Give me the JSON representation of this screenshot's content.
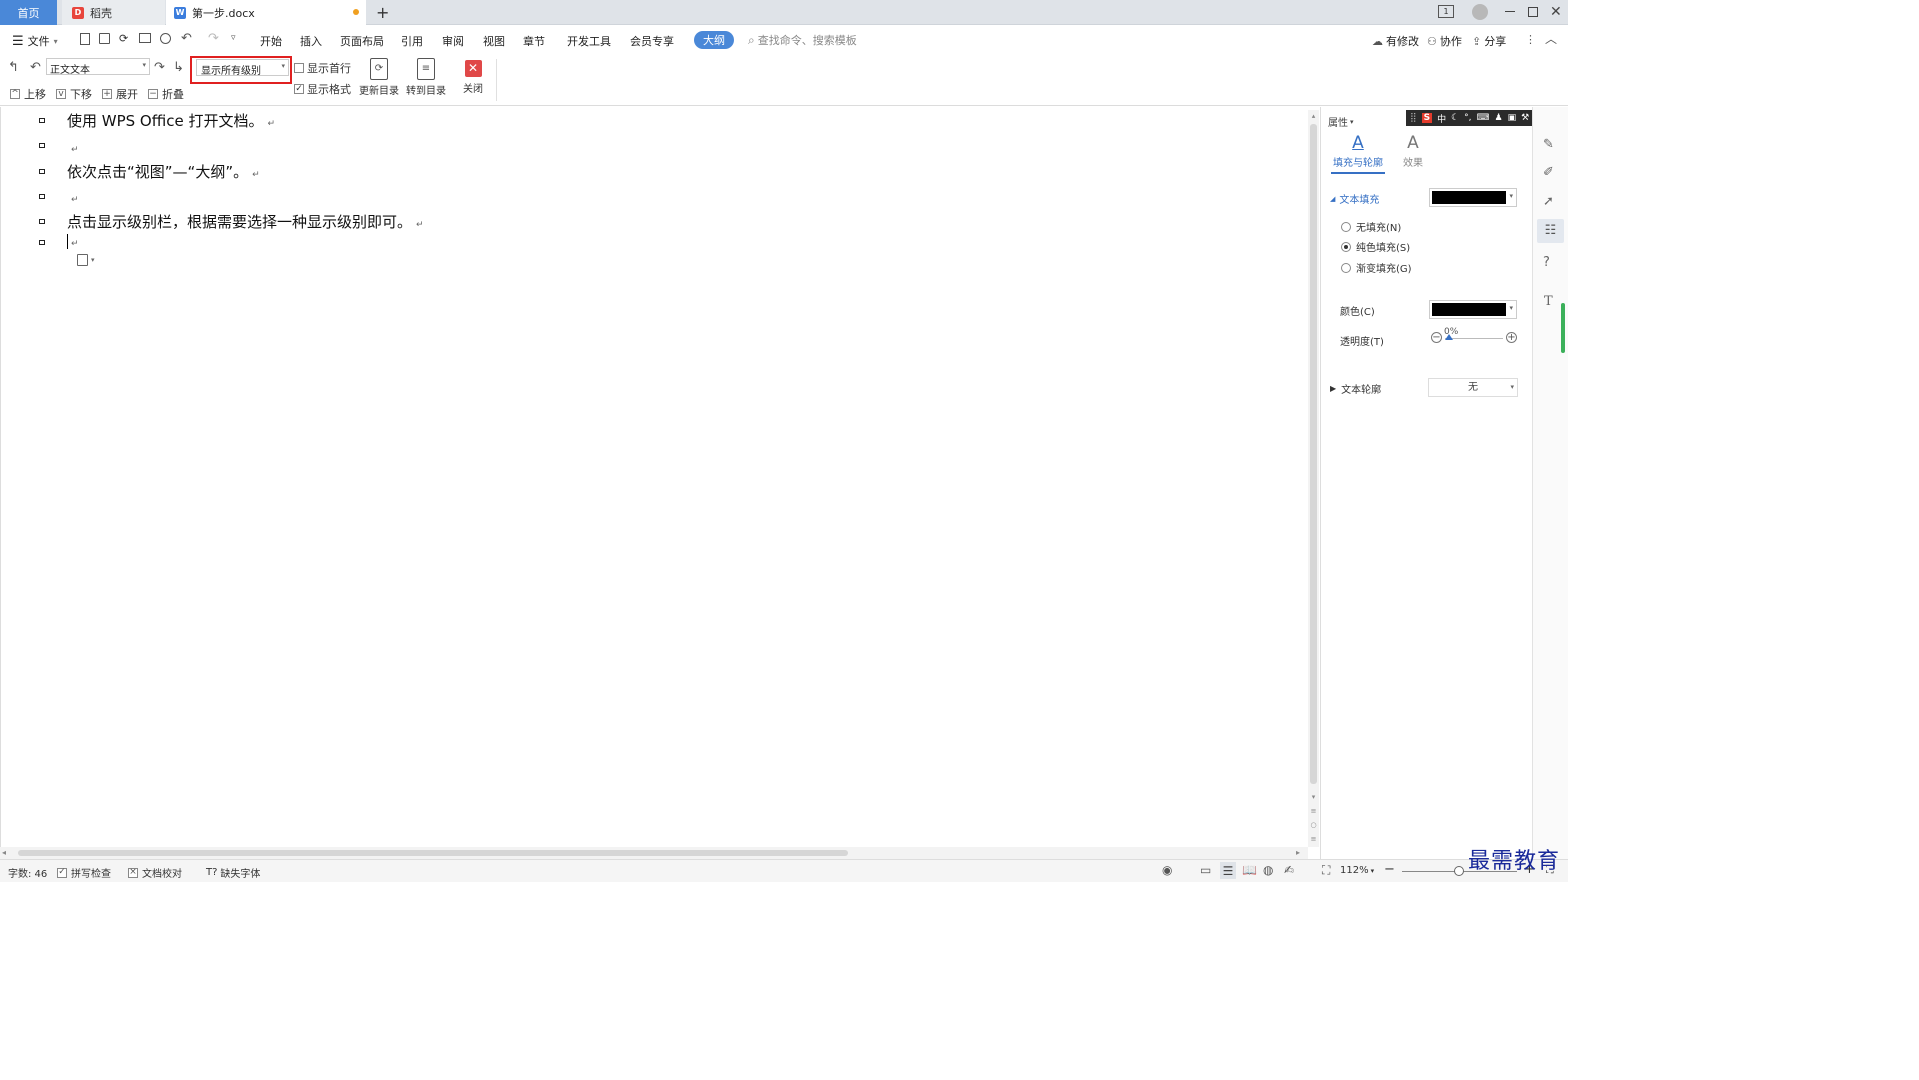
{
  "tabs": {
    "home": "首页",
    "daoke": "稻壳",
    "document": "第一步.docx",
    "new_tab": "+"
  },
  "menu": {
    "file": "文件",
    "items": [
      "开始",
      "插入",
      "页面布局",
      "引用",
      "审阅",
      "视图",
      "章节",
      "开发工具",
      "会员专享"
    ],
    "active": "大纲",
    "search_placeholder": "查找命令、搜索模板",
    "right": {
      "modified": "有修改",
      "collaborate": "协作",
      "share": "分享"
    }
  },
  "ribbon": {
    "style_select": "正文文本",
    "level_select": "显示所有级别",
    "show_first_line": "显示首行",
    "show_format": "显示格式",
    "update_toc": "更新目录",
    "goto_toc": "转到目录",
    "close": "关闭",
    "move_up": "上移",
    "move_down": "下移",
    "expand": "展开",
    "collapse": "折叠"
  },
  "document": {
    "paragraphs": [
      "使用 WPS Office 打开文档。",
      "",
      "依次点击“视图”—“大纲”。",
      "",
      "点击显示级别栏，根据需要选择一种显示级别即可。",
      ""
    ]
  },
  "panel": {
    "title": "属性",
    "tab_fill": "填充与轮廓",
    "tab_effect": "效果",
    "section_fill": "文本填充",
    "no_fill": "无填充(N)",
    "solid_fill": "纯色填充(S)",
    "gradient_fill": "渐变填充(G)",
    "color_label": "颜色(C)",
    "transparency_label": "透明度(T)",
    "transparency_value": "0%",
    "section_outline": "文本轮廓",
    "outline_value": "无",
    "fill_color": "#000000"
  },
  "ime": {
    "lang": "中"
  },
  "status": {
    "word_count": "字数: 46",
    "spell_check": "拼写检查",
    "doc_proof": "文档校对",
    "missing_font": "缺失字体",
    "zoom": "112%"
  },
  "watermark": "最需教育",
  "colors": {
    "accent": "#4a88d8",
    "highlight_box": "#e02020",
    "close_red": "#e04848"
  }
}
